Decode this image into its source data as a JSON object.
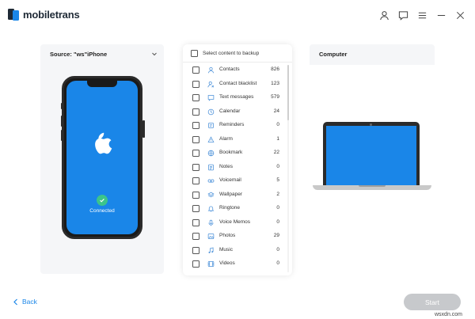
{
  "app": {
    "brand": "mobiletrans"
  },
  "window_icons": [
    "user-icon",
    "feedback-icon",
    "menu-icon",
    "minimize-icon",
    "close-icon"
  ],
  "source": {
    "title": "Source: \"ws\"iPhone",
    "status": "Connected"
  },
  "destination": {
    "title": "Computer"
  },
  "content_list": {
    "header": "Select content to backup",
    "items": [
      {
        "label": "Contacts",
        "count": "826",
        "icon": "contact-icon"
      },
      {
        "label": "Contact blacklist",
        "count": "123",
        "icon": "contact-blacklist-icon"
      },
      {
        "label": "Text messages",
        "count": "579",
        "icon": "message-icon"
      },
      {
        "label": "Calendar",
        "count": "24",
        "icon": "calendar-icon"
      },
      {
        "label": "Reminders",
        "count": "0",
        "icon": "reminder-icon"
      },
      {
        "label": "Alarm",
        "count": "1",
        "icon": "alarm-icon"
      },
      {
        "label": "Bookmark",
        "count": "22",
        "icon": "bookmark-icon"
      },
      {
        "label": "Notes",
        "count": "0",
        "icon": "notes-icon"
      },
      {
        "label": "Voicemail",
        "count": "5",
        "icon": "voicemail-icon"
      },
      {
        "label": "Wallpaper",
        "count": "2",
        "icon": "wallpaper-icon"
      },
      {
        "label": "Ringtone",
        "count": "0",
        "icon": "ringtone-icon"
      },
      {
        "label": "Voice Memos",
        "count": "0",
        "icon": "voice-memo-icon"
      },
      {
        "label": "Photos",
        "count": "29",
        "icon": "photo-icon"
      },
      {
        "label": "Music",
        "count": "0",
        "icon": "music-icon"
      },
      {
        "label": "Videos",
        "count": "0",
        "icon": "video-icon"
      }
    ]
  },
  "footer": {
    "back_label": "Back",
    "start_label": "Start"
  },
  "watermark": "wsxdn.com",
  "colors": {
    "accent": "#1a86e8",
    "success": "#3cc48b",
    "disabled": "#c7c9cc",
    "icon": "#4a90d9"
  }
}
